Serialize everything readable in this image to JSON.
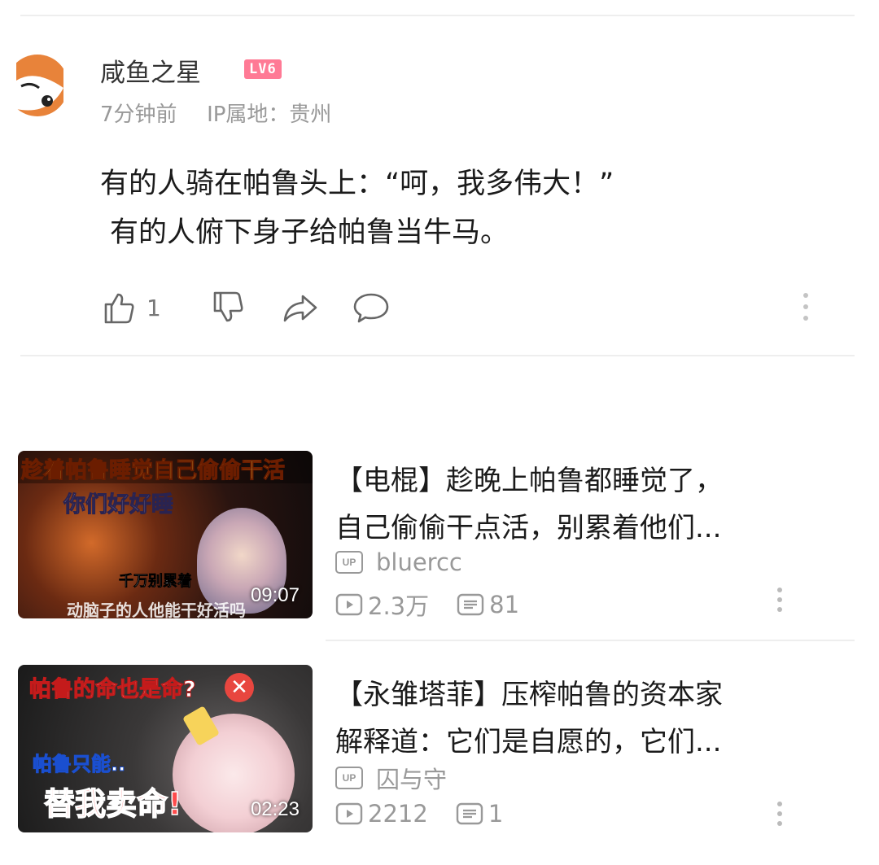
{
  "comment": {
    "username": "咸鱼之星",
    "level_badge": "LV6",
    "time": "7分钟前",
    "ip_location": "IP属地：贵州",
    "text_line1": "有的人骑在帕鲁头上：“呵，我多伟大！”",
    "text_line2": "有的人俯下身子给帕鲁当牛马。",
    "like_count": "1",
    "icons": [
      "like-icon",
      "dislike-icon",
      "share-icon",
      "reply-icon",
      "more-icon"
    ]
  },
  "videos": [
    {
      "title_line1": "【电棍】趁晚上帕鲁都睡觉了，",
      "title_line2": "自己偷偷干点活，别累着他们...",
      "up_badge": "UP",
      "uploader": "bluercc",
      "views": "2.3万",
      "danmaku": "81",
      "duration": "09:07",
      "thumb_text": {
        "caption_top": "趁着帕鲁睡觉自己偷偷干活",
        "caption_mid": "你们好好睡",
        "caption_small": "千万别累着",
        "caption_bottom": "动脑子的人他能干好活吗"
      }
    },
    {
      "title_line1": "【永雏塔菲】压榨帕鲁的资本家",
      "title_line2": "解释道：它们是自愿的，它们...",
      "up_badge": "UP",
      "uploader": "囚与守",
      "views": "2212",
      "danmaku": "1",
      "duration": "02:23",
      "thumb_text": {
        "caption_top": "帕鲁的命也是命?",
        "caption_mid": "帕鲁只能..",
        "caption_big": "替我卖命!"
      }
    }
  ],
  "colors": {
    "level_badge": "#ff7a95",
    "meta_gray": "#999999",
    "divider": "#eeeeee"
  }
}
